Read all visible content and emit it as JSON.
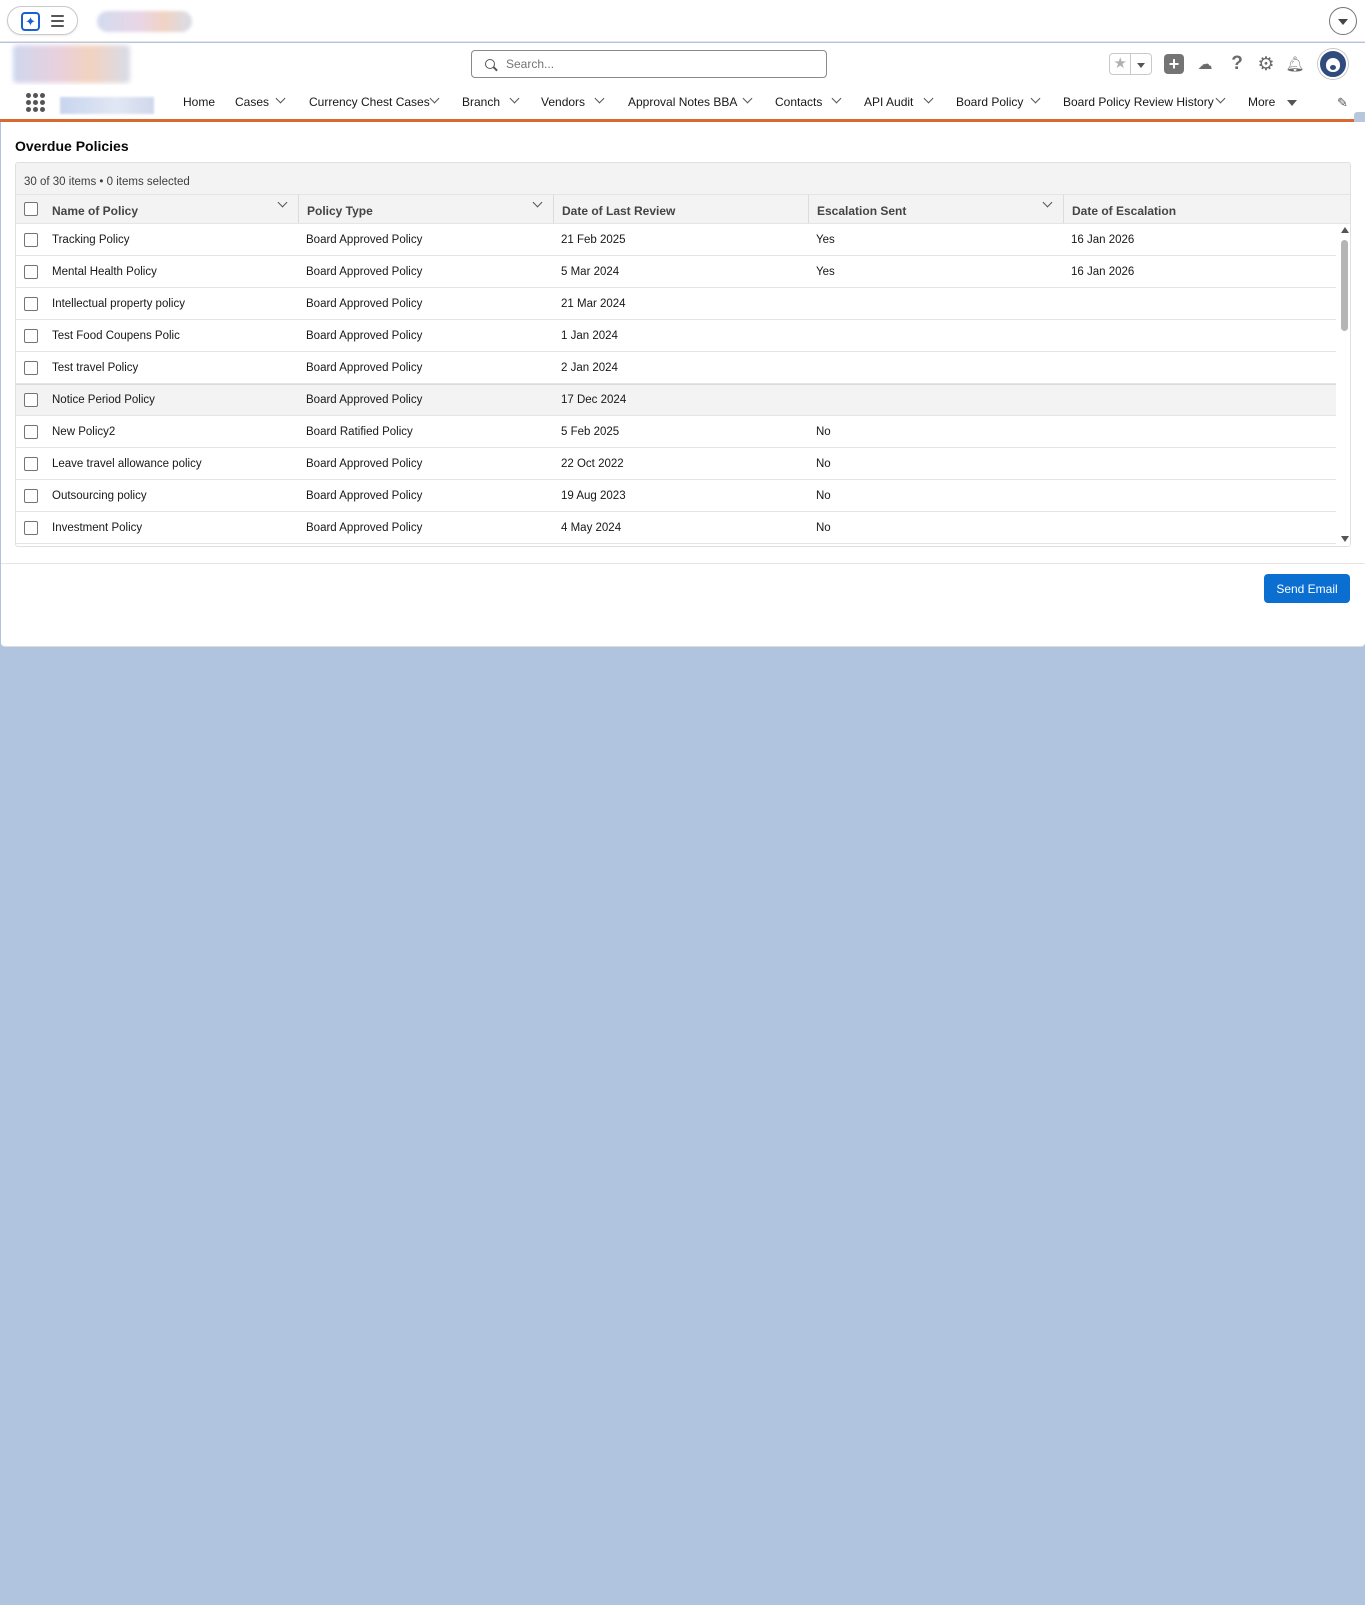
{
  "search": {
    "placeholder": "Search..."
  },
  "nav": {
    "items": [
      {
        "label": "Home",
        "has_menu": false
      },
      {
        "label": "Cases",
        "has_menu": true
      },
      {
        "label": "Currency Chest Cases",
        "has_menu": true
      },
      {
        "label": "Branch",
        "has_menu": true
      },
      {
        "label": "Vendors",
        "has_menu": true
      },
      {
        "label": "Approval Notes BBA",
        "has_menu": true
      },
      {
        "label": "Contacts",
        "has_menu": true
      },
      {
        "label": "API Audit",
        "has_menu": true
      },
      {
        "label": "Board Policy",
        "has_menu": true
      },
      {
        "label": "Board Policy Review History",
        "has_menu": true
      }
    ],
    "more_label": "More"
  },
  "page": {
    "title": "Overdue Policies"
  },
  "table": {
    "info": "30 of 30 items • 0 items selected",
    "columns": [
      "Name of Policy",
      "Policy Type",
      "Date of Last Review",
      "Escalation Sent",
      "Date of Escalation"
    ],
    "rows": [
      [
        "Tracking Policy",
        "Board Approved Policy",
        "21 Feb 2025",
        "Yes",
        "16 Jan 2026"
      ],
      [
        "Mental Health Policy",
        "Board Approved Policy",
        "5 Mar 2024",
        "Yes",
        "16 Jan 2026"
      ],
      [
        "Intellectual property policy",
        "Board Approved Policy",
        "21 Mar 2024",
        "",
        ""
      ],
      [
        "Test Food Coupens Polic",
        "Board Approved Policy",
        "1 Jan 2024",
        "",
        ""
      ],
      [
        "Test travel Policy",
        "Board Approved Policy",
        "2 Jan 2024",
        "",
        ""
      ],
      [
        "Notice Period Policy",
        "Board Approved Policy",
        "17 Dec 2024",
        "",
        ""
      ],
      [
        "New Policy2",
        "Board Ratified Policy",
        "5 Feb 2025",
        "No",
        ""
      ],
      [
        "Leave travel allowance policy",
        "Board Approved Policy",
        "22 Oct 2022",
        "No",
        ""
      ],
      [
        "Outsourcing policy",
        "Board Approved Policy",
        "19 Aug 2023",
        "No",
        ""
      ],
      [
        "Investment Policy",
        "Board Approved Policy",
        "4 May 2024",
        "No",
        ""
      ]
    ]
  },
  "actions": {
    "send_email": "Send Email"
  },
  "colors": {
    "brand_button": "#0b6fd1",
    "nav_underline": "#d86a2f",
    "background": "#b0c4df"
  }
}
